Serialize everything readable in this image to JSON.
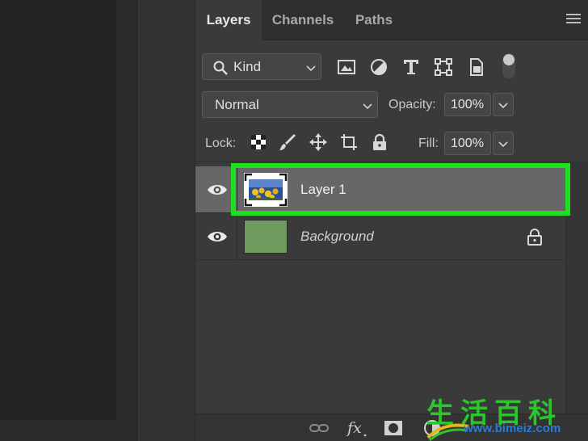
{
  "tabs": [
    {
      "label": "Layers",
      "active": true
    },
    {
      "label": "Channels",
      "active": false
    },
    {
      "label": "Paths",
      "active": false
    }
  ],
  "filter": {
    "kind_label": "Kind",
    "icons": [
      "image-filter-icon",
      "adjustment-filter-icon",
      "type-filter-icon",
      "shape-filter-icon",
      "smart-object-filter-icon"
    ]
  },
  "blend": {
    "mode": "Normal",
    "opacity_label": "Opacity:",
    "opacity_value": "100%"
  },
  "lock": {
    "label": "Lock:",
    "icons": [
      "lock-transparent-icon",
      "lock-image-icon",
      "lock-position-icon",
      "lock-artboard-icon",
      "lock-all-icon"
    ],
    "fill_label": "Fill:",
    "fill_value": "100%"
  },
  "layers": [
    {
      "name": "Layer 1",
      "selected": true,
      "visible": true,
      "locked": false
    },
    {
      "name": "Background",
      "selected": false,
      "visible": true,
      "locked": true
    }
  ],
  "colors": {
    "highlight": "#1fe01f",
    "background_thumb": "#6f9a5e",
    "selected_row": "#676767"
  },
  "watermark": {
    "title": "生活百科",
    "url": "www.bimeiz.com"
  }
}
